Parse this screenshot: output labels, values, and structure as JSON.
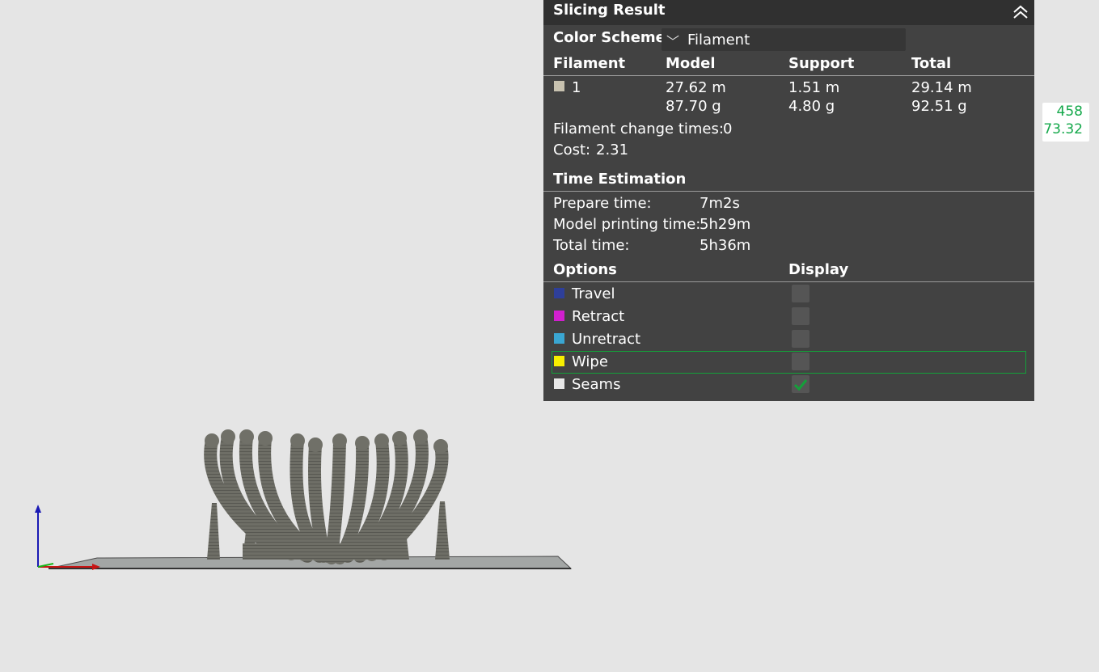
{
  "panel": {
    "title": "Slicing Result",
    "color_scheme": {
      "label": "Color Scheme",
      "value": "Filament"
    },
    "filament_table": {
      "headers": [
        "Filament",
        "Model",
        "Support",
        "Total"
      ],
      "row": {
        "id": "1",
        "swatch_color": "#c8c2b0",
        "model_length": "27.62 m",
        "model_weight": "87.70 g",
        "support_length": "1.51 m",
        "support_weight": "4.80 g",
        "total_length": "29.14 m",
        "total_weight": "92.51 g"
      }
    },
    "change_times": {
      "label": "Filament change times:",
      "value": "0"
    },
    "cost": {
      "label": "Cost:",
      "value": "2.31"
    },
    "time_estimation": {
      "header": "Time Estimation",
      "rows": [
        {
          "label": "Prepare time:",
          "value": "7m2s"
        },
        {
          "label": "Model printing time:",
          "value": "5h29m"
        },
        {
          "label": "Total time:",
          "value": "5h36m"
        }
      ]
    },
    "options": {
      "header": "Options",
      "display_header": "Display",
      "items": [
        {
          "label": "Travel",
          "color": "#2e3f9a",
          "checked": false
        },
        {
          "label": "Retract",
          "color": "#d11fcf",
          "checked": false
        },
        {
          "label": "Unretract",
          "color": "#3aa6d2",
          "checked": false
        },
        {
          "label": "Wipe",
          "color": "#f7ef00",
          "checked": false,
          "highlighted": true
        },
        {
          "label": "Seams",
          "color": "#e8e8e8",
          "checked": true
        }
      ]
    }
  },
  "layer_badge": {
    "layer": "458",
    "height": "73.32"
  },
  "colors": {
    "accent": "#14a03a",
    "panel_bg": "#424242",
    "title_bg": "#303030",
    "viewport_bg": "#e5e5e5"
  },
  "icons": [
    "collapse-icon",
    "chevron-down-icon",
    "checkmark-icon"
  ]
}
